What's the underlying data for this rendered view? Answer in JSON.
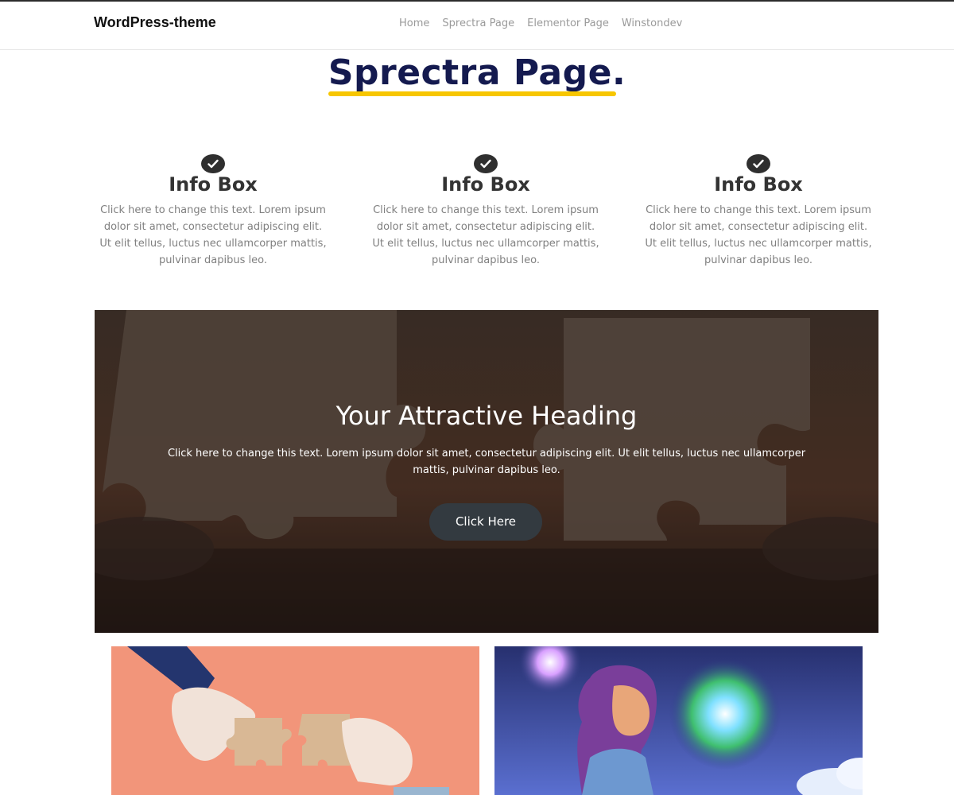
{
  "site": {
    "title": "WordPress-theme"
  },
  "nav": {
    "items": [
      {
        "label": "Home"
      },
      {
        "label": "Sprectra Page"
      },
      {
        "label": "Elementor Page"
      },
      {
        "label": "Winstondev"
      }
    ]
  },
  "page": {
    "title": "Sprectra Page",
    "title_suffix": ".",
    "accent_color": "#f7c600",
    "title_color": "#141a4f"
  },
  "info_boxes": [
    {
      "icon": "check-circle-icon",
      "title": "Info Box",
      "text": "Click here to change this text. Lorem ipsum dolor sit amet, consectetur adipiscing elit. Ut elit tellus, luctus nec ullamcorper mattis, pulvinar dapibus leo."
    },
    {
      "icon": "check-circle-icon",
      "title": "Info Box",
      "text": "Click here to change this text. Lorem ipsum dolor sit amet, consectetur adipiscing elit. Ut elit tellus, luctus nec ullamcorper mattis, pulvinar dapibus leo."
    },
    {
      "icon": "check-circle-icon",
      "title": "Info Box",
      "text": "Click here to change this text. Lorem ipsum dolor sit amet, consectetur adipiscing elit. Ut elit tellus, luctus nec ullamcorper mattis, pulvinar dapibus leo."
    }
  ],
  "hero": {
    "heading": "Your Attractive Heading",
    "text": "Click here to change this text. Lorem ipsum dolor sit amet, consectetur adipiscing elit. Ut elit tellus, luctus nec ullamcorper mattis, pulvinar dapibus leo.",
    "button_label": "Click Here",
    "button_color": "#333a40"
  }
}
